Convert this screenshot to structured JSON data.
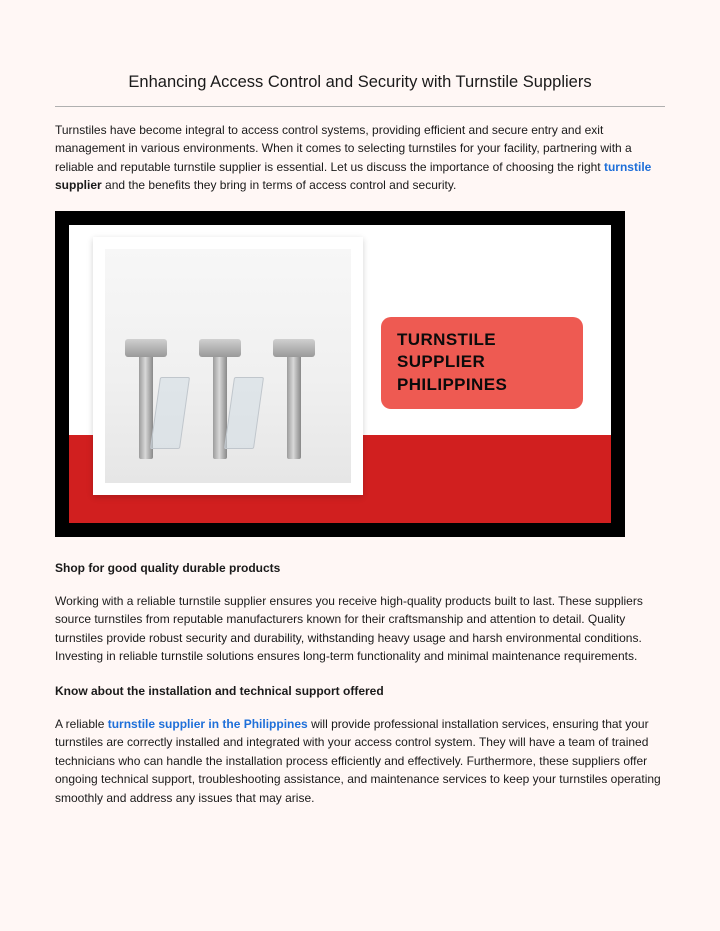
{
  "title": "Enhancing Access Control and Security with Turnstile Suppliers",
  "intro": {
    "pre": "Turnstiles have become integral to access control systems, providing efficient and secure entry and exit management in various environments. When it comes to selecting turnstiles for your facility, partnering with a reliable and reputable turnstile supplier is essential. Let us discuss the importance of choosing the right ",
    "link": "turnstile",
    "mid": " supplier",
    "post": " and the benefits they bring in terms of access control and security."
  },
  "banner": {
    "line1": "TURNSTILE SUPPLIER",
    "line2": "PHILIPPINES"
  },
  "section1": {
    "heading": "Shop for good quality durable products",
    "body": "Working with a reliable turnstile supplier ensures you receive high-quality products built to last. These suppliers source turnstiles from reputable manufacturers known for their craftsmanship and attention to detail. Quality turnstiles provide robust security and durability, withstanding heavy usage and harsh environmental conditions. Investing in reliable turnstile solutions ensures long-term functionality and minimal maintenance requirements."
  },
  "section2": {
    "heading": "Know about the installation and technical support offered",
    "pre": "A reliable ",
    "link": "turnstile supplier in the Philippines",
    "post": " will provide professional installation services, ensuring that your turnstiles are correctly installed and integrated with your access control system. They will have a team of trained technicians who can handle the installation process efficiently and effectively. Furthermore, these suppliers offer ongoing technical support, troubleshooting assistance, and maintenance services to keep your turnstiles operating smoothly and address any issues that may arise."
  }
}
